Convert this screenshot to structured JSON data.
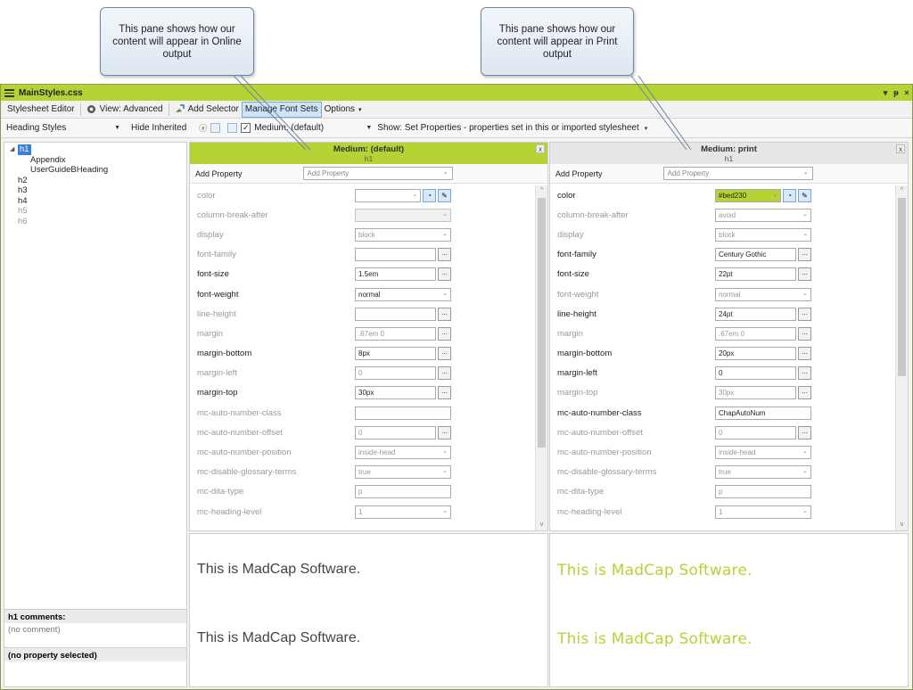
{
  "callouts": {
    "online": [
      "This pane shows how our",
      "content will appear in Online",
      "output"
    ],
    "print": [
      "This pane shows how our",
      "content will appear in Print",
      "output"
    ]
  },
  "window": {
    "title": "MainStyles.css",
    "controls": [
      "▾",
      "ᵽ",
      "×"
    ]
  },
  "toolbar1": {
    "stylesheet_editor": "Stylesheet Editor",
    "view": "View: Advanced",
    "add_selector": "Add Selector",
    "manage_font_sets": "Manage Font Sets",
    "options": "Options"
  },
  "toolbar2": {
    "heading_styles": "Heading Styles",
    "hide_inherited": "Hide Inherited",
    "medium": "Medium: (default)",
    "show": "Show: Set Properties - properties set in this or imported stylesheet"
  },
  "tree": [
    {
      "label": "h1",
      "level": 0,
      "selected": true,
      "dim": false,
      "toggle": "◢"
    },
    {
      "label": "Appendix",
      "level": 1,
      "selected": false,
      "dim": false,
      "toggle": ""
    },
    {
      "label": "UserGuideBHeading",
      "level": 1,
      "selected": false,
      "dim": false,
      "toggle": ""
    },
    {
      "label": "h2",
      "level": 0,
      "selected": false,
      "dim": false,
      "toggle": ""
    },
    {
      "label": "h3",
      "level": 0,
      "selected": false,
      "dim": false,
      "toggle": ""
    },
    {
      "label": "h4",
      "level": 0,
      "selected": false,
      "dim": false,
      "toggle": ""
    },
    {
      "label": "h5",
      "level": 0,
      "selected": false,
      "dim": true,
      "toggle": ""
    },
    {
      "label": "h6",
      "level": 0,
      "selected": false,
      "dim": true,
      "toggle": ""
    }
  ],
  "comments": {
    "heading": "h1 comments:",
    "body": "(no comment)",
    "property": "(no property selected)"
  },
  "panes": {
    "online": {
      "title": "Medium: (default)",
      "subtitle": "h1",
      "add_property_label": "Add Property",
      "add_property_placeholder": "Add Property",
      "properties": [
        {
          "name": "color",
          "value": "",
          "set": false,
          "kind": "color"
        },
        {
          "name": "column-break-after",
          "value": "",
          "set": false,
          "kind": "select-gray"
        },
        {
          "name": "display",
          "value": "block",
          "set": false,
          "kind": "select-inh"
        },
        {
          "name": "font-family",
          "value": "",
          "set": false,
          "kind": "ellipsis"
        },
        {
          "name": "font-size",
          "value": "1.5em",
          "set": true,
          "kind": "ellipsis"
        },
        {
          "name": "font-weight",
          "value": "normal",
          "set": true,
          "kind": "select"
        },
        {
          "name": "line-height",
          "value": "",
          "set": false,
          "kind": "ellipsis"
        },
        {
          "name": "margin",
          "value": ".67em 0",
          "set": false,
          "kind": "ellipsis-inh"
        },
        {
          "name": "margin-bottom",
          "value": "8px",
          "set": true,
          "kind": "ellipsis"
        },
        {
          "name": "margin-left",
          "value": "0",
          "set": false,
          "kind": "ellipsis-inh"
        },
        {
          "name": "margin-top",
          "value": "30px",
          "set": true,
          "kind": "ellipsis"
        },
        {
          "name": "mc-auto-number-class",
          "value": "",
          "set": false,
          "kind": "text"
        },
        {
          "name": "mc-auto-number-offset",
          "value": "0",
          "set": false,
          "kind": "ellipsis-inh"
        },
        {
          "name": "mc-auto-number-position",
          "value": "inside-head",
          "set": false,
          "kind": "select-inh"
        },
        {
          "name": "mc-disable-glossary-terms",
          "value": "true",
          "set": false,
          "kind": "select-inh"
        },
        {
          "name": "mc-dita-type",
          "value": "p",
          "set": false,
          "kind": "text-inh"
        },
        {
          "name": "mc-heading-level",
          "value": "1",
          "set": false,
          "kind": "select-inh"
        }
      ]
    },
    "print": {
      "title": "Medium: print",
      "subtitle": "h1",
      "add_property_label": "Add Property",
      "add_property_placeholder": "Add Property",
      "properties": [
        {
          "name": "color",
          "value": "#bed230",
          "set": true,
          "kind": "color"
        },
        {
          "name": "column-break-after",
          "value": "avoid",
          "set": false,
          "kind": "select-inh"
        },
        {
          "name": "display",
          "value": "block",
          "set": false,
          "kind": "select-inh"
        },
        {
          "name": "font-family",
          "value": "Century Gothic",
          "set": true,
          "kind": "ellipsis"
        },
        {
          "name": "font-size",
          "value": "22pt",
          "set": true,
          "kind": "ellipsis"
        },
        {
          "name": "font-weight",
          "value": "normal",
          "set": false,
          "kind": "select-inh"
        },
        {
          "name": "line-height",
          "value": "24pt",
          "set": true,
          "kind": "ellipsis"
        },
        {
          "name": "margin",
          "value": ".67em 0",
          "set": false,
          "kind": "ellipsis-inh"
        },
        {
          "name": "margin-bottom",
          "value": "20px",
          "set": true,
          "kind": "ellipsis"
        },
        {
          "name": "margin-left",
          "value": "0",
          "set": true,
          "kind": "ellipsis"
        },
        {
          "name": "margin-top",
          "value": "30px",
          "set": false,
          "kind": "ellipsis-inh"
        },
        {
          "name": "mc-auto-number-class",
          "value": "ChapAutoNum",
          "set": true,
          "kind": "text"
        },
        {
          "name": "mc-auto-number-offset",
          "value": "0",
          "set": false,
          "kind": "ellipsis-inh"
        },
        {
          "name": "mc-auto-number-position",
          "value": "inside-head",
          "set": false,
          "kind": "select-inh"
        },
        {
          "name": "mc-disable-glossary-terms",
          "value": "true",
          "set": false,
          "kind": "select-inh"
        },
        {
          "name": "mc-dita-type",
          "value": "p",
          "set": false,
          "kind": "text-inh"
        },
        {
          "name": "mc-heading-level",
          "value": "1",
          "set": false,
          "kind": "select-inh"
        }
      ]
    }
  },
  "preview": {
    "online": [
      "This is MadCap Software.",
      "This is MadCap Software."
    ],
    "print": [
      "This is MadCap Software.",
      "This is MadCap Software."
    ]
  },
  "colors": {
    "accent_green": "#b5d334",
    "selection_blue": "#3a7fd6"
  }
}
